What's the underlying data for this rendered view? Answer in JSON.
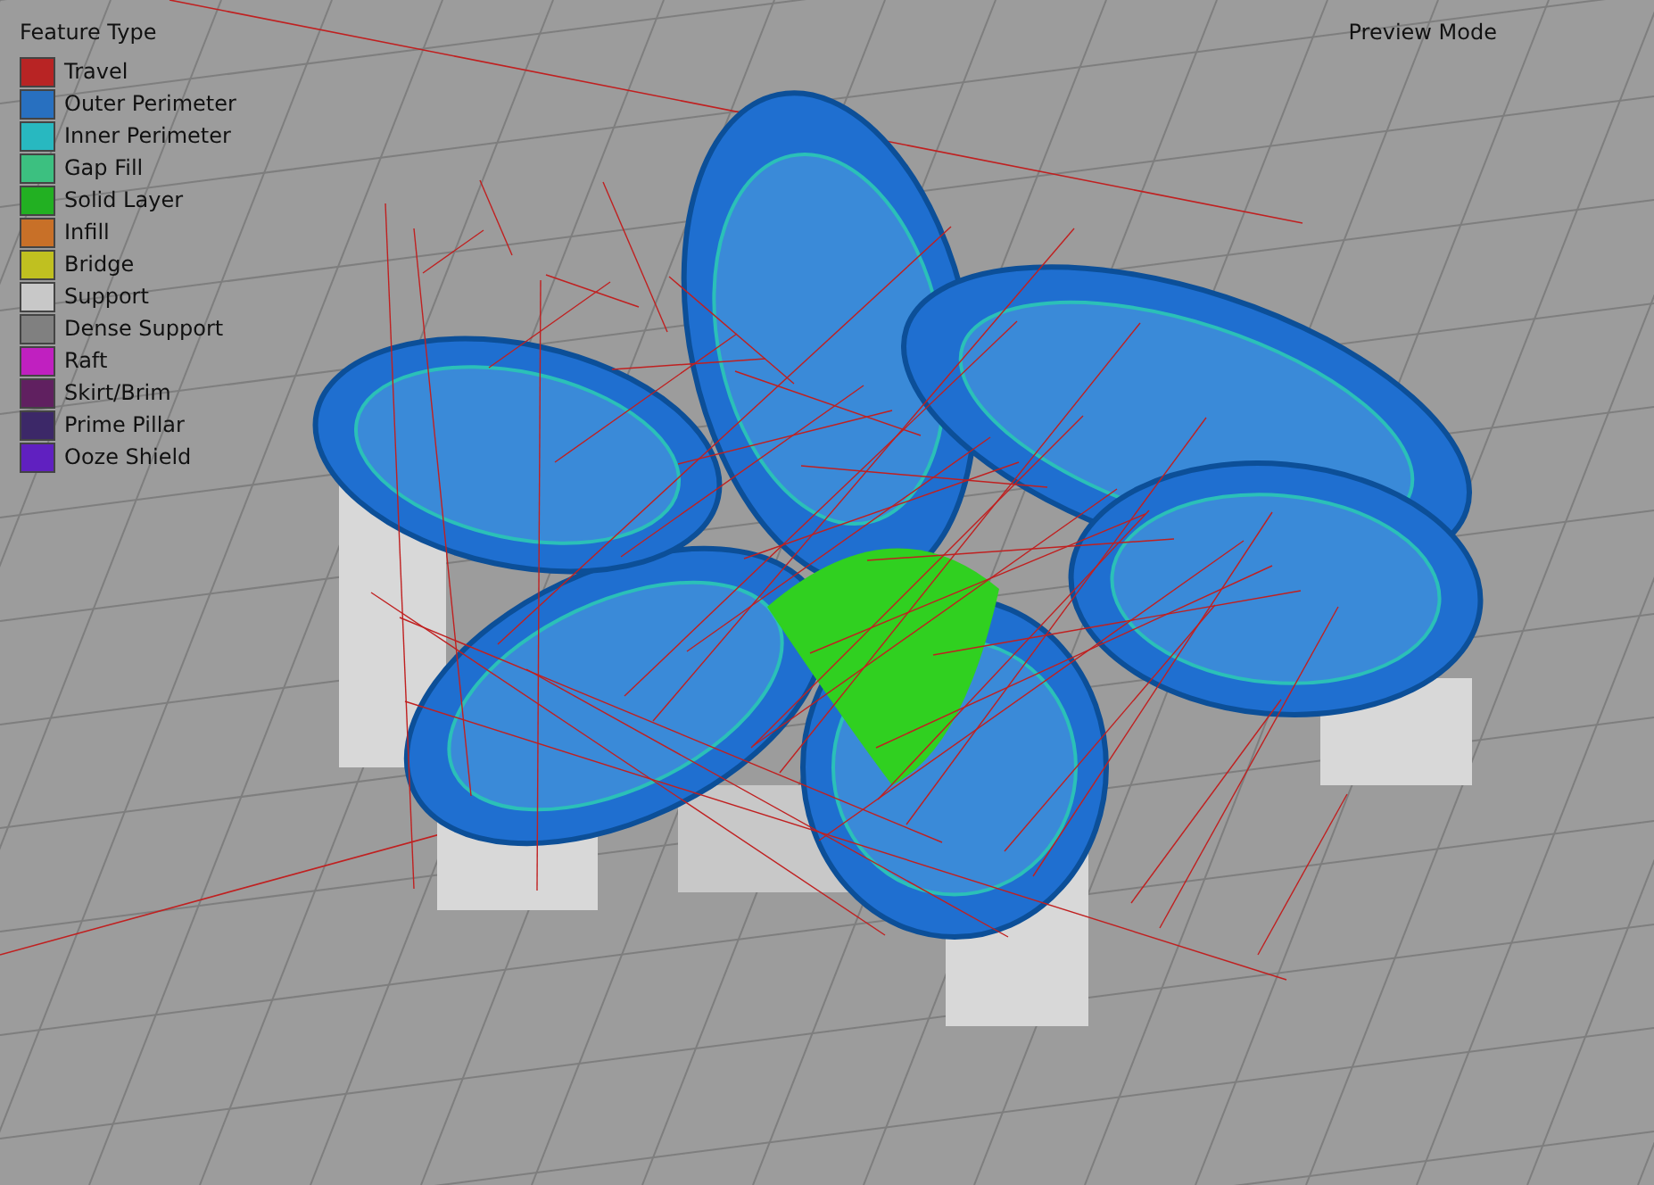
{
  "legend": {
    "title": "Feature Type",
    "items": [
      {
        "label": "Travel",
        "color": "#b82424"
      },
      {
        "label": "Outer Perimeter",
        "color": "#2870c0"
      },
      {
        "label": "Inner Perimeter",
        "color": "#28b8c0"
      },
      {
        "label": "Gap Fill",
        "color": "#3cc080"
      },
      {
        "label": "Solid Layer",
        "color": "#22b022"
      },
      {
        "label": "Infill",
        "color": "#c87028"
      },
      {
        "label": "Bridge",
        "color": "#c0c020"
      },
      {
        "label": "Support",
        "color": "#c8c8c8"
      },
      {
        "label": "Dense Support",
        "color": "#808080"
      },
      {
        "label": "Raft",
        "color": "#c020c0"
      },
      {
        "label": "Skirt/Brim",
        "color": "#602060"
      },
      {
        "label": "Prime Pillar",
        "color": "#3c2868"
      },
      {
        "label": "Ooze Shield",
        "color": "#6020c0"
      }
    ]
  },
  "mode_label": "Preview Mode"
}
